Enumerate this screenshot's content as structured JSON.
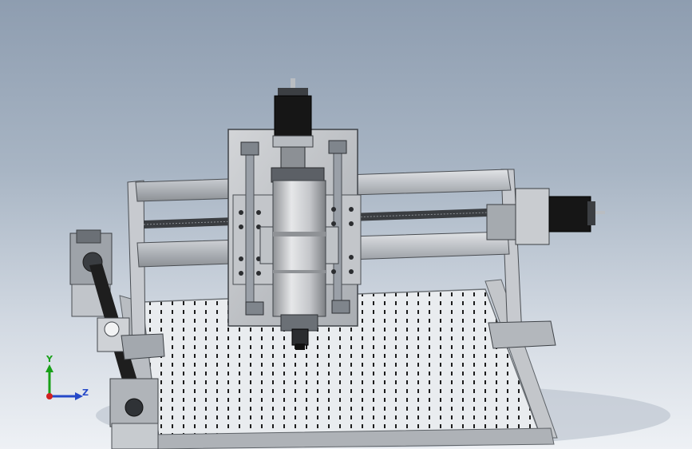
{
  "triad": {
    "y_label": "Y",
    "z_label": "Z",
    "colors": {
      "y": "#18a018",
      "z": "#2548c8",
      "x": "#d22020"
    }
  },
  "colors": {
    "background_top": "#8e9db0",
    "background_bottom": "#eef1f5",
    "aluminum": "#c8cbd0",
    "steel": "#9aa0a8",
    "dark_metal": "#2b2b2b",
    "motor_black": "#161616"
  }
}
